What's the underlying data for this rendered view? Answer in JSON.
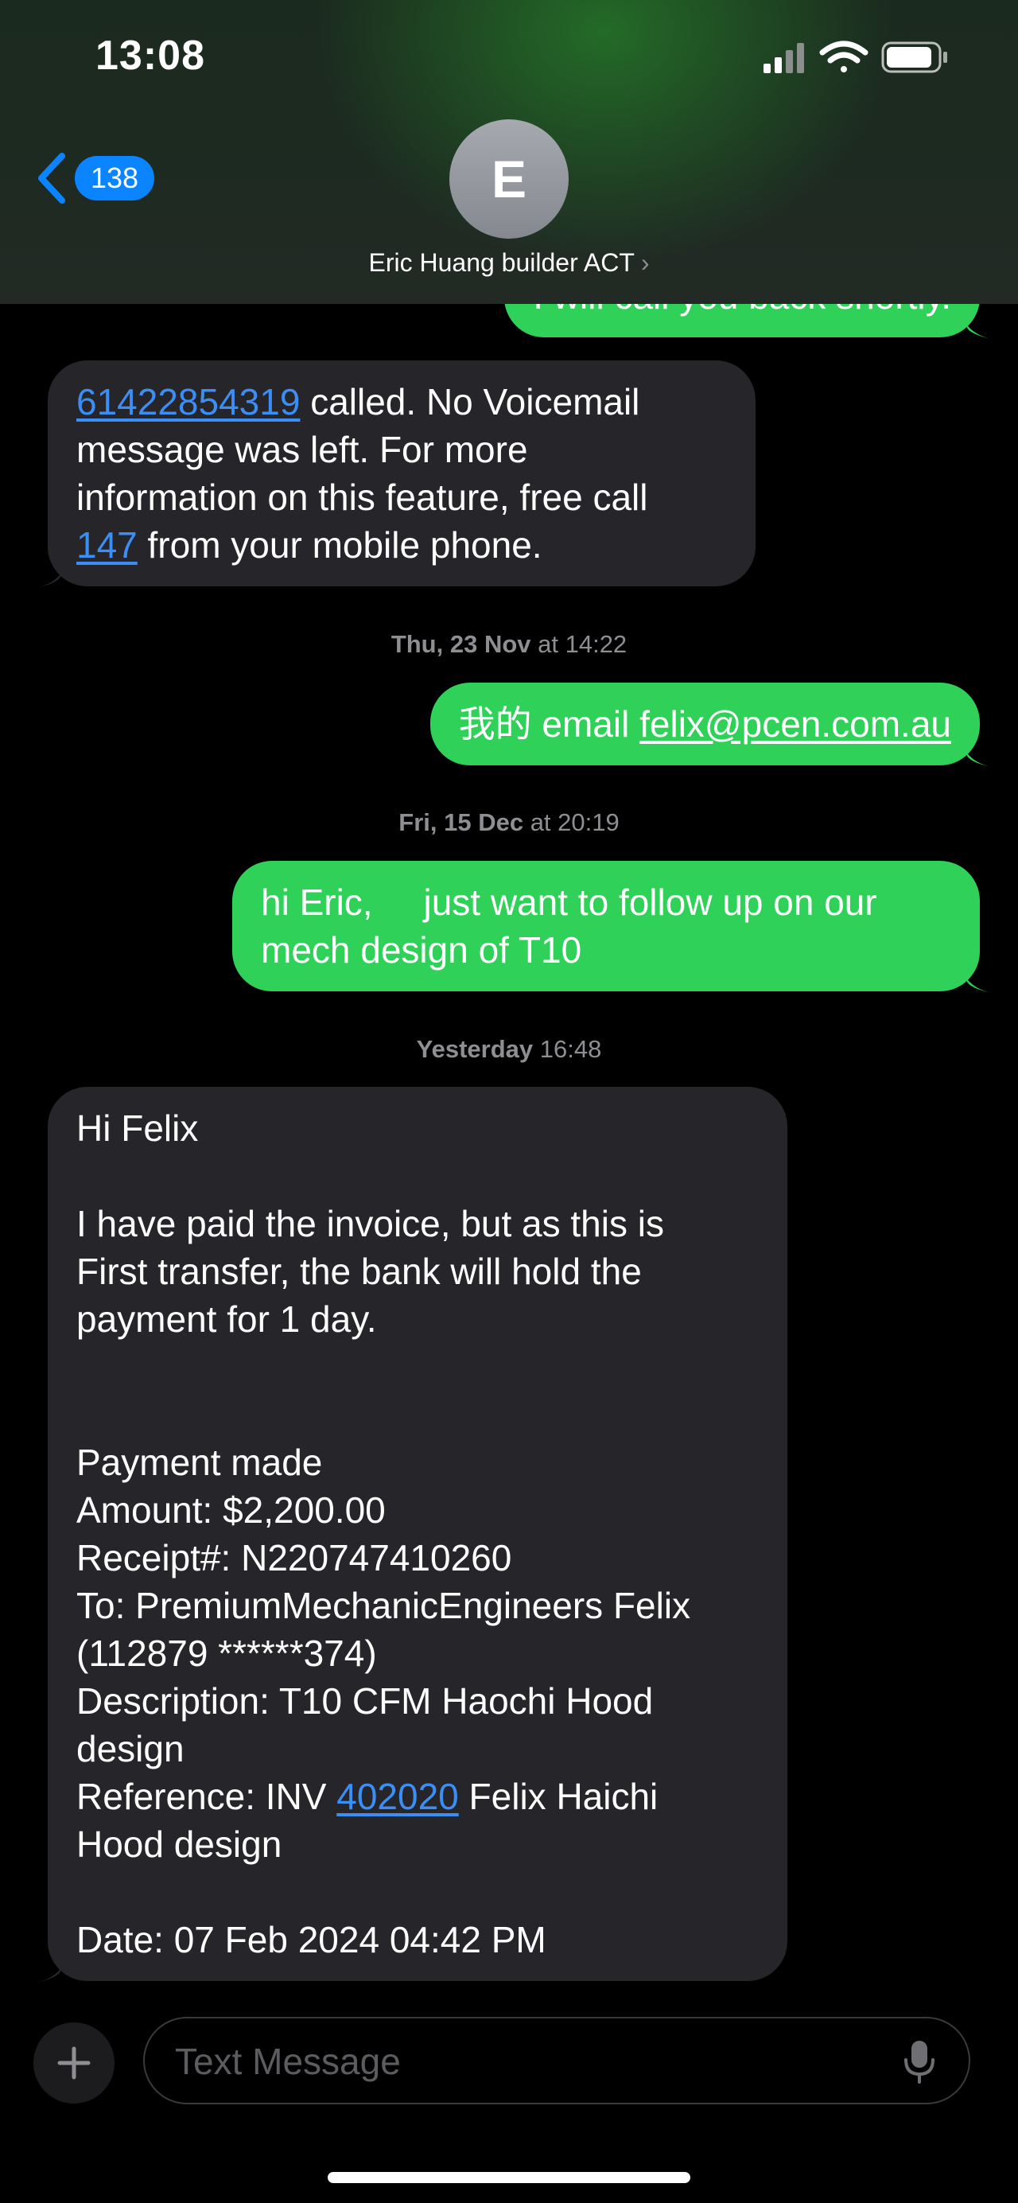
{
  "status_bar": {
    "time": "13:08"
  },
  "nav": {
    "back_count": "138",
    "avatar_initial": "E",
    "contact_name": "Eric Huang builder ACT",
    "chevron": "›"
  },
  "messages": [
    {
      "direction": "outgoing",
      "lines": [
        [
          {
            "t": "I will call you back shortly."
          }
        ]
      ]
    },
    {
      "direction": "incoming",
      "lines": [
        [
          {
            "t": "61422854319",
            "link": true
          },
          {
            "t": " called. No Voicemail"
          }
        ],
        [
          {
            "t": "message was left. For more"
          }
        ],
        [
          {
            "t": "information on this feature, free call"
          }
        ],
        [
          {
            "t": "147",
            "link": true
          },
          {
            "t": " from your mobile phone."
          }
        ]
      ]
    },
    {
      "direction": "outgoing",
      "lines": [
        [
          {
            "t": "我的 email "
          },
          {
            "t": "felix@pcen.com.au",
            "link": true
          }
        ]
      ]
    },
    {
      "direction": "outgoing",
      "lines": [
        [
          {
            "t": "hi Eric,     just want to follow up on our"
          }
        ],
        [
          {
            "t": "mech design of T10"
          }
        ]
      ]
    },
    {
      "direction": "incoming",
      "lines": [
        [
          {
            "t": "Hi Felix"
          }
        ],
        [],
        [
          {
            "t": "I have paid the invoice, but as this is"
          }
        ],
        [
          {
            "t": "First transfer, the bank will hold the"
          }
        ],
        [
          {
            "t": "payment for 1 day."
          }
        ],
        [],
        [],
        [
          {
            "t": "Payment made"
          }
        ],
        [
          {
            "t": "Amount: $2,200.00"
          }
        ],
        [
          {
            "t": "Receipt#: N220747410260"
          }
        ],
        [
          {
            "t": "To: PremiumMechanicEngineers Felix"
          }
        ],
        [
          {
            "t": "(112879 ******374)"
          }
        ],
        [
          {
            "t": "Description: T10 CFM Haochi Hood"
          }
        ],
        [
          {
            "t": "design"
          }
        ],
        [
          {
            "t": "Reference: INV "
          },
          {
            "t": "402020",
            "link": true
          },
          {
            "t": " Felix Haichi"
          }
        ],
        [
          {
            "t": "Hood design"
          }
        ],
        [],
        [
          {
            "t": "Date: 07 Feb 2024 04:42 PM"
          }
        ]
      ]
    }
  ],
  "timestamps": [
    {
      "day": "Thu, 23 Nov",
      "time": " at 14:22"
    },
    {
      "day": "Fri, 15 Dec",
      "time": " at 20:19"
    },
    {
      "day": "Yesterday",
      "time": " 16:48"
    }
  ],
  "composer": {
    "placeholder": "Text Message"
  },
  "icons": {
    "back": "chevron-left-icon",
    "signal": "cellular-signal-icon",
    "wifi": "wifi-icon",
    "battery": "battery-icon",
    "add": "plus-icon",
    "mic": "microphone-icon"
  },
  "colors": {
    "outgoing_bubble": "#30d158",
    "incoming_bubble": "#26262a",
    "link": "#3a8ef6",
    "accent": "#0a84ff"
  }
}
